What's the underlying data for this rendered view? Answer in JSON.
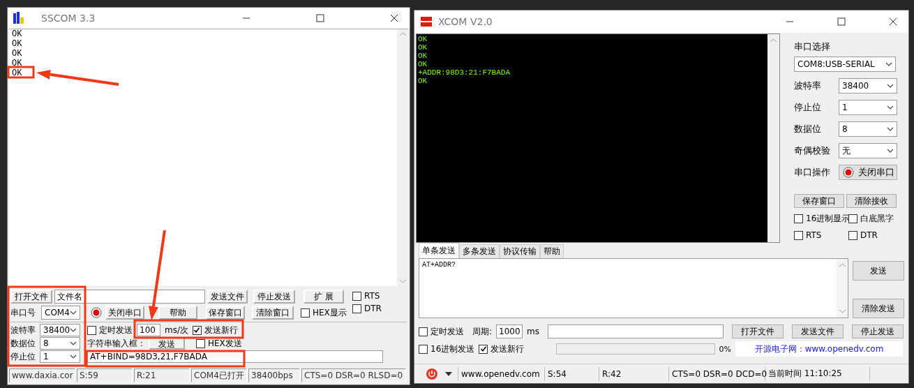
{
  "sscom": {
    "title": "SSCOM 3.3",
    "receive_lines": [
      "OK",
      "OK",
      "OK",
      "OK",
      "OK"
    ],
    "open_file_button": "打开文件",
    "file_name": "文件名",
    "send_file_button": "发送文件",
    "stop_send_button": "停止发送",
    "expand_button": "扩 展",
    "rts": {
      "label": "RTS",
      "checked": false
    },
    "dtr": {
      "label": "DTR",
      "checked": false
    },
    "port_label": "串口号",
    "port": "COM4",
    "port_open": true,
    "close_port_button": "关闭串口",
    "help_button": "帮助",
    "save_window_button": "保存窗口",
    "clear_window_button": "清除窗口",
    "hex_display": {
      "label": "HEX显示",
      "checked": false
    },
    "settings": [
      {
        "label": "波特率",
        "value": "38400"
      },
      {
        "label": "数据位",
        "value": "8"
      },
      {
        "label": "停止位",
        "value": "1"
      }
    ],
    "timed_send": {
      "label": "定时发送",
      "checked": false
    },
    "interval": "100",
    "interval_unit": "ms/次",
    "send_newline": {
      "label": "发送新行",
      "checked": true
    },
    "input_label": "字符串输入框：",
    "send_button": "发送",
    "hex_send": {
      "label": "HEX发送",
      "checked": false
    },
    "send_text": "AT+BIND=98D3,21,F7BADA",
    "status_bar": [
      "www.daxia.cor",
      "S:59",
      "R:21",
      "COM4已打开",
      "38400bps",
      "CTS=0 DSR=0 RLSD=0"
    ]
  },
  "xcom": {
    "title": "XCOM V2.0",
    "receive_lines": [
      "OK",
      "OK",
      "OK",
      "OK",
      "+ADDR:98D3:21:F7BADA",
      "OK"
    ],
    "port_select_label": "串口选择",
    "port": "COM8:USB-SERIAL",
    "settings": [
      {
        "label": "波特率",
        "value": "38400"
      },
      {
        "label": "停止位",
        "value": "1"
      },
      {
        "label": "数据位",
        "value": "8"
      },
      {
        "label": "奇偶校验",
        "value": "无"
      }
    ],
    "port_op_label": "串口操作",
    "port_open": true,
    "close_port_button": "关闭串口",
    "save_window_button": "保存窗口",
    "clear_receive_button": "清除接收",
    "options": [
      {
        "label": "16进制显示",
        "checked": false
      },
      {
        "label": "白底黑字",
        "checked": false
      },
      {
        "label": "RTS",
        "checked": false
      },
      {
        "label": "DTR",
        "checked": false
      }
    ],
    "tabs": [
      {
        "label": "单条发送",
        "selected": true
      },
      {
        "label": "多条发送",
        "selected": false
      },
      {
        "label": "协议传输",
        "selected": false
      },
      {
        "label": "帮助",
        "selected": false
      }
    ],
    "send_text": "AT+ADDR?",
    "send_button": "发送",
    "clear_send_button": "清除发送",
    "timed_send": {
      "label": "定时发送",
      "checked": false
    },
    "period_label": "周期:",
    "period": "1000",
    "period_unit": "ms",
    "open_file_button": "打开文件",
    "send_file_button": "发送文件",
    "stop_send_button": "停止发送",
    "hex_send": {
      "label": "16进制发送",
      "checked": false
    },
    "send_newline": {
      "label": "发送新行",
      "checked": true
    },
    "progress": {
      "level": 0
    },
    "progress_text": "0%",
    "site_banner": "开源电子网：www.openedv.com",
    "status_bar": [
      "www.openedv.com",
      "S:54",
      "R:42",
      "CTS=0 DSR=0 DCD=0",
      "当前时间 11:10:25"
    ]
  },
  "annotations": [
    {
      "kind": "box"
    },
    {
      "kind": "arrow"
    },
    {
      "kind": "box"
    },
    {
      "kind": "box"
    },
    {
      "kind": "arrow"
    },
    {
      "kind": "box"
    }
  ]
}
